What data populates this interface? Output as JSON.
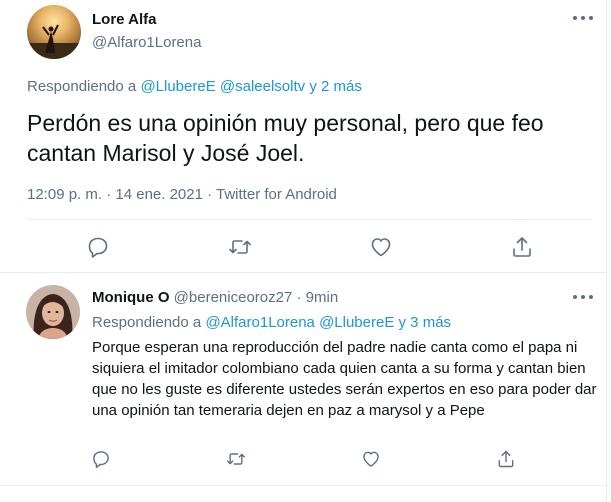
{
  "main_tweet": {
    "author_name": "Lore Alfa",
    "author_handle": "@Alfaro1Lorena",
    "reply_prefix": "Respondiendo a",
    "reply_mentions": "@LlubereE @saleelsoltv",
    "reply_suffix": "y 2 más",
    "text": "Perdón es una opinión muy personal, pero que feo cantan Marisol y José Joel.",
    "meta": "12:09 p. m. · 14 ene. 2021 · Twitter for Android"
  },
  "reply_tweet": {
    "author_name": "Monique O",
    "author_handle": "@bereniceoroz27",
    "separator": "·",
    "time": "9min",
    "reply_prefix": "Respondiendo a",
    "reply_mentions": "@Alfaro1Lorena @LlubereE",
    "reply_suffix": "y 3 más",
    "text": "Porque esperan una reproducción del padre nadie canta como el papa ni siquiera el imitador colombiano cada quien canta a su forma y cantan bien que no les guste es diferente ustedes serán expertos en eso para poder dar una opinión tan temeraria dejen en paz a marysol y a Pepe"
  },
  "icons": {
    "reply": "reply-icon",
    "retweet": "retweet-icon",
    "like": "like-icon",
    "share": "share-icon",
    "more": "more-icon"
  },
  "colors": {
    "text": "#0f1419",
    "secondary": "#5b7083",
    "link": "#1b95e0",
    "border": "#e6ecf0"
  }
}
